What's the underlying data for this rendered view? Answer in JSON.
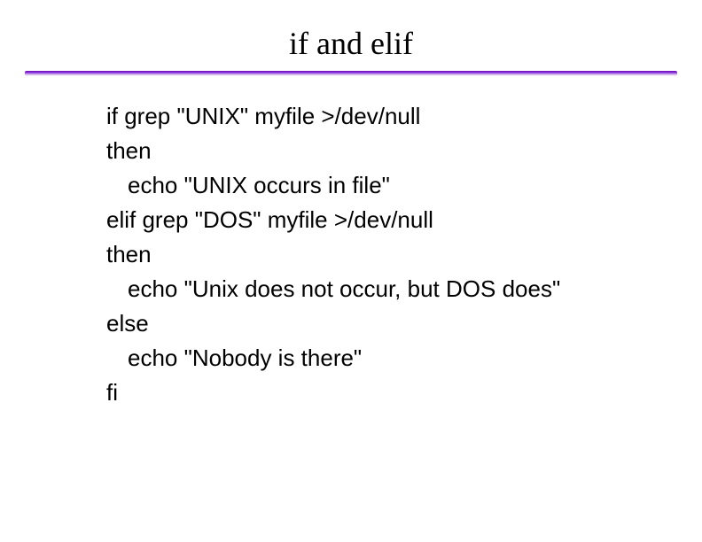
{
  "title": "if and elif",
  "code": {
    "l1": "if grep \"UNIX\" myfile >/dev/null",
    "l2": "then",
    "l3": "echo \"UNIX occurs in file\"",
    "l4": "elif grep \"DOS\" myfile >/dev/null",
    "l5": "then",
    "l6": "echo \"Unix does not occur, but DOS does\"",
    "l7": "else",
    "l8": "echo \"Nobody is there\"",
    "l9": "fi"
  }
}
